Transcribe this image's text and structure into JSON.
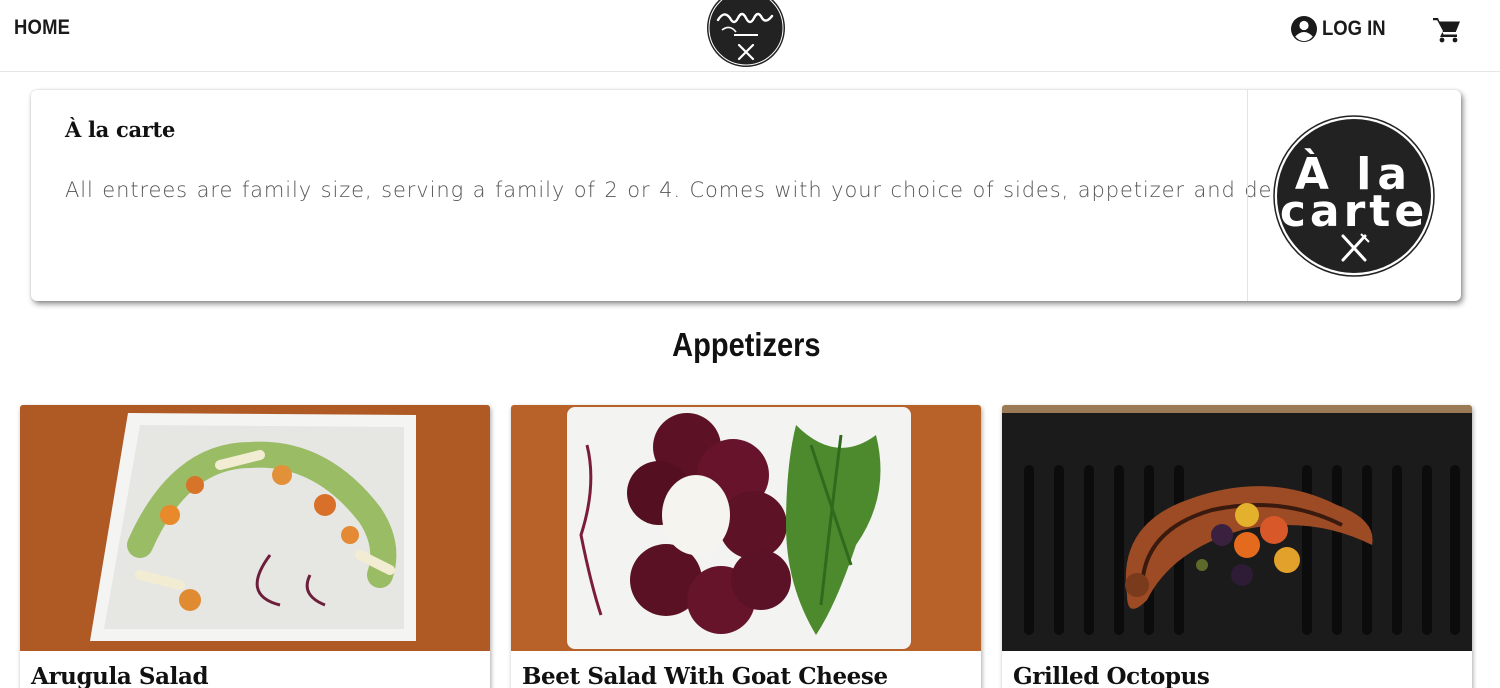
{
  "header": {
    "home_label": "HOME",
    "login_label": "LOG IN",
    "logo_icon": "peacock-gourmet-logo",
    "cart_icon": "cart-icon",
    "account_icon": "account-circle-icon"
  },
  "info_card": {
    "title": "À la carte",
    "description": "All entrees are family size, serving a family of 2 or 4. Comes with your choice of sides, appetizer and dessert.",
    "badge_icon": "a-la-carte-badge"
  },
  "section": {
    "title": "Appetizers"
  },
  "products": [
    {
      "title": "Arugula Salad",
      "photo": "arugula-salad-photo"
    },
    {
      "title": "Beet Salad With Goat Cheese",
      "photo": "beet-salad-photo"
    },
    {
      "title": "Grilled Octopus",
      "photo": "grilled-octopus-photo"
    }
  ],
  "colors": {
    "text": "#111111",
    "muted_text": "#555555",
    "logo_dark": "#222222",
    "wood": "#b8622a",
    "grill": "#1c1c1c"
  }
}
